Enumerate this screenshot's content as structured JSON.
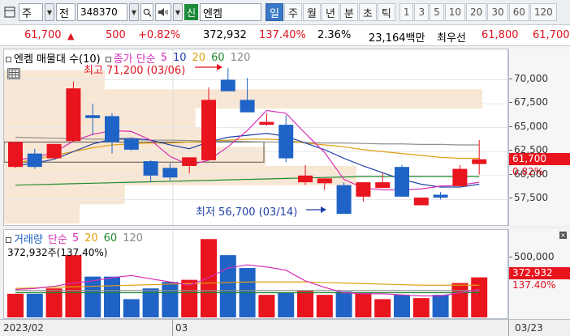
{
  "toolbar": {
    "market_select": "주",
    "type_select": "전",
    "code": "348370",
    "badge": "신",
    "name": "엔켐",
    "periods": [
      "일",
      "주",
      "월",
      "년",
      "분",
      "초",
      "틱"
    ],
    "active_period": "일",
    "intervals": [
      "1",
      "3",
      "5",
      "10",
      "20",
      "30",
      "60",
      "120"
    ]
  },
  "quote": {
    "price": "61,700",
    "change": "500",
    "change_pct": "+0.82%",
    "volume": "372,932",
    "volume_ratio": "137.40%",
    "turnover": "2.36%",
    "amount": "23,164백만",
    "ask_label": "최우선",
    "ask1": "61,800",
    "ask2": "61,700"
  },
  "price_panel": {
    "legend_title": "엔켐 매물대 수(10)",
    "ma_label": "종가 단순",
    "ma_periods": [
      "5",
      "10",
      "20",
      "60",
      "120"
    ],
    "ma_colors": [
      "#d62fb8",
      "#1f3fa6",
      "#e0a010",
      "#1f8a2e",
      "#888888"
    ],
    "high_note": "최고 71,200 (03/06)",
    "low_note": "최저 56,700 (03/14)",
    "axis_ticks": [
      "70,000",
      "67,500",
      "65,000",
      "62,500",
      "60,000",
      "57,500"
    ],
    "current_label": "61,700",
    "current_pct": "0.82%"
  },
  "volume_panel": {
    "legend_title": "거래량",
    "ma_label": "단순",
    "ma_periods": [
      "5",
      "20",
      "60",
      "120"
    ],
    "current_text": "372,932주(137.40%)",
    "axis_tick": "500,000",
    "current_label": "372,932",
    "current_pct": "137.40%"
  },
  "x_axis": {
    "labels": [
      "2023/02",
      "03",
      "03/23"
    ]
  },
  "colors": {
    "up": "#e8141e",
    "down": "#1f63c6",
    "accent": "#3a78c8"
  },
  "chart_data": {
    "type": "candlestick",
    "ylim": [
      55000,
      73000
    ],
    "yticks": [
      57500,
      60000,
      62500,
      65000,
      67500,
      70000
    ],
    "candles": [
      {
        "o": 60900,
        "h": 63500,
        "l": 60800,
        "c": 63500
      },
      {
        "o": 62300,
        "h": 62800,
        "l": 60700,
        "c": 60900
      },
      {
        "o": 61800,
        "h": 63300,
        "l": 61700,
        "c": 63300
      },
      {
        "o": 63600,
        "h": 69800,
        "l": 63500,
        "c": 69100
      },
      {
        "o": 66300,
        "h": 67500,
        "l": 64200,
        "c": 66000
      },
      {
        "o": 66200,
        "h": 66500,
        "l": 62300,
        "c": 63500
      },
      {
        "o": 63800,
        "h": 64000,
        "l": 62600,
        "c": 62700
      },
      {
        "o": 61500,
        "h": 61600,
        "l": 59400,
        "c": 60000
      },
      {
        "o": 60800,
        "h": 61300,
        "l": 59500,
        "c": 59800
      },
      {
        "o": 61000,
        "h": 61900,
        "l": 60200,
        "c": 61900
      },
      {
        "o": 61600,
        "h": 69200,
        "l": 61600,
        "c": 67900
      },
      {
        "o": 70000,
        "h": 71200,
        "l": 69500,
        "c": 68800
      },
      {
        "o": 67900,
        "h": 70200,
        "l": 66900,
        "c": 66600
      },
      {
        "o": 65300,
        "h": 66500,
        "l": 65200,
        "c": 65600
      },
      {
        "o": 65300,
        "h": 66300,
        "l": 61400,
        "c": 61800
      },
      {
        "o": 59300,
        "h": 61100,
        "l": 59000,
        "c": 60000
      },
      {
        "o": 59200,
        "h": 59700,
        "l": 58500,
        "c": 59700
      },
      {
        "o": 59000,
        "h": 59300,
        "l": 56700,
        "c": 56000
      },
      {
        "o": 57800,
        "h": 59200,
        "l": 57300,
        "c": 59300
      },
      {
        "o": 58700,
        "h": 60300,
        "l": 58700,
        "c": 59300
      },
      {
        "o": 60900,
        "h": 61100,
        "l": 57800,
        "c": 57800
      },
      {
        "o": 56900,
        "h": 57600,
        "l": 56900,
        "c": 57700
      },
      {
        "o": 58000,
        "h": 58300,
        "l": 57500,
        "c": 57700
      },
      {
        "o": 58900,
        "h": 61100,
        "l": 58800,
        "c": 60700
      },
      {
        "o": 61200,
        "h": 63700,
        "l": 60100,
        "c": 61700
      }
    ],
    "ma5": [
      61600,
      61900,
      62400,
      63600,
      64300,
      64700,
      64600,
      63700,
      62000,
      61100,
      61600,
      63000,
      64700,
      66800,
      66500,
      64400,
      62400,
      59600,
      58700,
      58500,
      58500,
      58600,
      58900,
      59000,
      59300
    ],
    "ma10": [
      61000,
      61300,
      61700,
      62500,
      63300,
      63800,
      63900,
      63700,
      63200,
      62800,
      63500,
      64000,
      64200,
      64400,
      64100,
      63400,
      62700,
      61800,
      61000,
      60300,
      59600,
      59100,
      58800,
      58800,
      59100
    ],
    "ma20": [
      61300,
      61700,
      62100,
      62500,
      62900,
      63200,
      63300,
      63400,
      63400,
      63500,
      63600,
      63700,
      63800,
      63800,
      63700,
      63400,
      63200,
      63000,
      62700,
      62500,
      62300,
      62100,
      61900,
      61800,
      61800
    ],
    "ma60": [
      59000,
      59050,
      59100,
      59150,
      59200,
      59250,
      59300,
      59350,
      59400,
      59450,
      59500,
      59550,
      59600,
      59650,
      59700,
      59750,
      59800,
      59850,
      59900,
      59900,
      59900,
      59900,
      59900,
      59900,
      59900
    ],
    "ma120": [
      64000,
      63950,
      63900,
      63850,
      63800,
      63800,
      63750,
      63700,
      63700,
      63650,
      63600,
      63600,
      63550,
      63500,
      63500,
      63450,
      63400,
      63400,
      63350,
      63300,
      63300,
      63250,
      63250,
      63200,
      63200
    ],
    "volume_profile": [
      {
        "low": 55000,
        "high": 57000,
        "vol": 0.15
      },
      {
        "low": 57000,
        "high": 59000,
        "vol": 0.24
      },
      {
        "low": 59000,
        "high": 61000,
        "vol": 0.7
      },
      {
        "low": 61000,
        "high": 63000,
        "vol": 0.52
      },
      {
        "low": 63000,
        "high": 65000,
        "vol": 0.42
      },
      {
        "low": 65000,
        "high": 67000,
        "vol": 0.38
      },
      {
        "low": 67000,
        "high": 69000,
        "vol": 0.95
      },
      {
        "low": 69000,
        "high": 71000,
        "vol": 0.2
      }
    ],
    "volume": {
      "ylim": [
        0,
        800000
      ],
      "yticks": [
        500000
      ],
      "values": [
        220000,
        220000,
        270000,
        580000,
        380000,
        380000,
        170000,
        270000,
        330000,
        350000,
        730000,
        580000,
        460000,
        210000,
        230000,
        250000,
        210000,
        240000,
        230000,
        170000,
        210000,
        180000,
        210000,
        320000,
        372932
      ],
      "ma5": [
        260000,
        270000,
        290000,
        320000,
        340000,
        370000,
        390000,
        360000,
        330000,
        300000,
        370000,
        460000,
        490000,
        470000,
        440000,
        340000,
        280000,
        230000,
        220000,
        220000,
        210000,
        200000,
        200000,
        230000,
        260000
      ],
      "ma20": [
        270000,
        275000,
        280000,
        285000,
        290000,
        295000,
        300000,
        305000,
        310000,
        315000,
        320000,
        325000,
        330000,
        330000,
        330000,
        330000,
        325000,
        320000,
        315000,
        310000,
        305000,
        300000,
        300000,
        300000,
        300000
      ],
      "ma60": [
        230000,
        230000,
        230000,
        230000,
        230000,
        230000,
        230000,
        230000,
        230000,
        230000,
        230000,
        230000,
        230000,
        230000,
        230000,
        230000,
        230000,
        230000,
        230000,
        230000,
        230000,
        230000,
        230000,
        230000,
        230000
      ],
      "ma120": [
        250000,
        250000,
        250000,
        250000,
        250000,
        250000,
        250000,
        250000,
        250000,
        250000,
        250000,
        250000,
        250000,
        250000,
        250000,
        250000,
        250000,
        250000,
        250000,
        250000,
        250000,
        250000,
        250000,
        250000,
        250000
      ]
    }
  }
}
